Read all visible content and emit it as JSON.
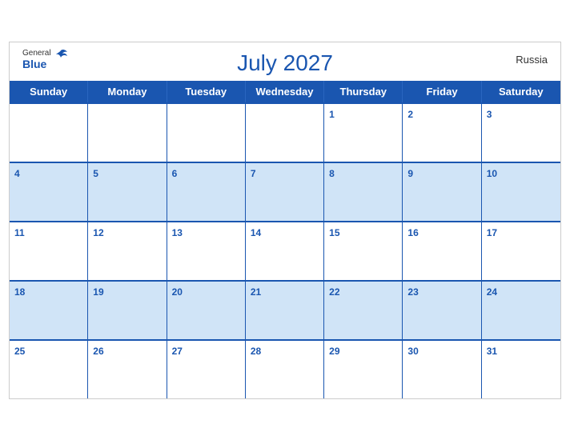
{
  "calendar": {
    "title": "July 2027",
    "country": "Russia",
    "days": [
      "Sunday",
      "Monday",
      "Tuesday",
      "Wednesday",
      "Thursday",
      "Friday",
      "Saturday"
    ],
    "weeks": [
      [
        {
          "date": "",
          "bg": "white"
        },
        {
          "date": "",
          "bg": "white"
        },
        {
          "date": "",
          "bg": "white"
        },
        {
          "date": "",
          "bg": "white"
        },
        {
          "date": "1",
          "bg": "white"
        },
        {
          "date": "2",
          "bg": "white"
        },
        {
          "date": "3",
          "bg": "white"
        }
      ],
      [
        {
          "date": "4",
          "bg": "blue"
        },
        {
          "date": "5",
          "bg": "blue"
        },
        {
          "date": "6",
          "bg": "blue"
        },
        {
          "date": "7",
          "bg": "blue"
        },
        {
          "date": "8",
          "bg": "blue"
        },
        {
          "date": "9",
          "bg": "blue"
        },
        {
          "date": "10",
          "bg": "blue"
        }
      ],
      [
        {
          "date": "11",
          "bg": "white"
        },
        {
          "date": "12",
          "bg": "white"
        },
        {
          "date": "13",
          "bg": "white"
        },
        {
          "date": "14",
          "bg": "white"
        },
        {
          "date": "15",
          "bg": "white"
        },
        {
          "date": "16",
          "bg": "white"
        },
        {
          "date": "17",
          "bg": "white"
        }
      ],
      [
        {
          "date": "18",
          "bg": "blue"
        },
        {
          "date": "19",
          "bg": "blue"
        },
        {
          "date": "20",
          "bg": "blue"
        },
        {
          "date": "21",
          "bg": "blue"
        },
        {
          "date": "22",
          "bg": "blue"
        },
        {
          "date": "23",
          "bg": "blue"
        },
        {
          "date": "24",
          "bg": "blue"
        }
      ],
      [
        {
          "date": "25",
          "bg": "white"
        },
        {
          "date": "26",
          "bg": "white"
        },
        {
          "date": "27",
          "bg": "white"
        },
        {
          "date": "28",
          "bg": "white"
        },
        {
          "date": "29",
          "bg": "white"
        },
        {
          "date": "30",
          "bg": "white"
        },
        {
          "date": "31",
          "bg": "white"
        }
      ]
    ],
    "logo": {
      "general": "General",
      "blue": "Blue"
    },
    "colors": {
      "blue": "#1a56b0",
      "light_blue": "#d0e4f7",
      "white": "#ffffff"
    }
  }
}
